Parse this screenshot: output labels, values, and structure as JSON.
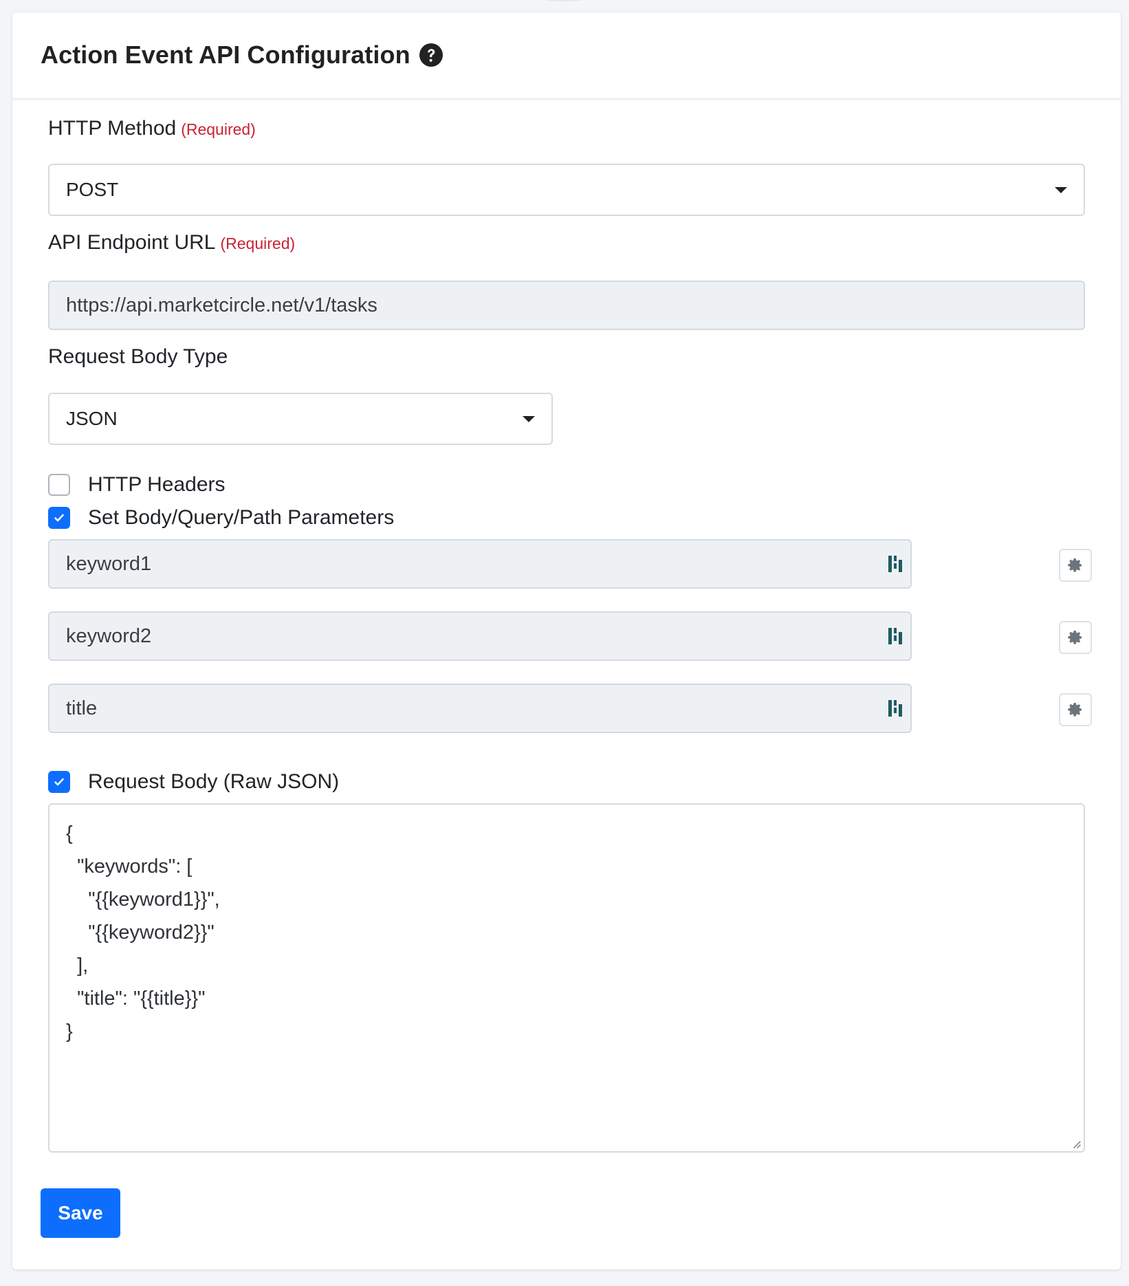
{
  "card": {
    "title": "Action Event API Configuration"
  },
  "http_method": {
    "label": "HTTP Method",
    "required": "(Required)",
    "value": "POST"
  },
  "endpoint": {
    "label": "API Endpoint URL",
    "required": "(Required)",
    "value": "https://api.marketcircle.net/v1/tasks"
  },
  "body_type": {
    "label": "Request Body Type",
    "value": "JSON"
  },
  "http_headers": {
    "label": "HTTP Headers",
    "checked": false
  },
  "params": {
    "label": "Set Body/Query/Path Parameters",
    "checked": true,
    "items": [
      "keyword1",
      "keyword2",
      "title"
    ]
  },
  "raw_body": {
    "label": "Request Body (Raw JSON)",
    "checked": true,
    "content": "{\n  \"keywords\": [\n    \"{{keyword1}}\",\n    \"{{keyword2}}\"\n  ],\n  \"title\": \"{{title}}\"\n}"
  },
  "save": {
    "label": "Save"
  },
  "colors": {
    "primary": "#0d6efd",
    "required": "#c82333",
    "readonly_bg": "#eef1f4",
    "brand_icon": "#1f5b63"
  },
  "icons": {
    "help": "question-circle-icon",
    "caret": "caret-down-icon",
    "brand": "daylight-brand-icon",
    "gear": "gear-icon",
    "check": "check-icon"
  }
}
